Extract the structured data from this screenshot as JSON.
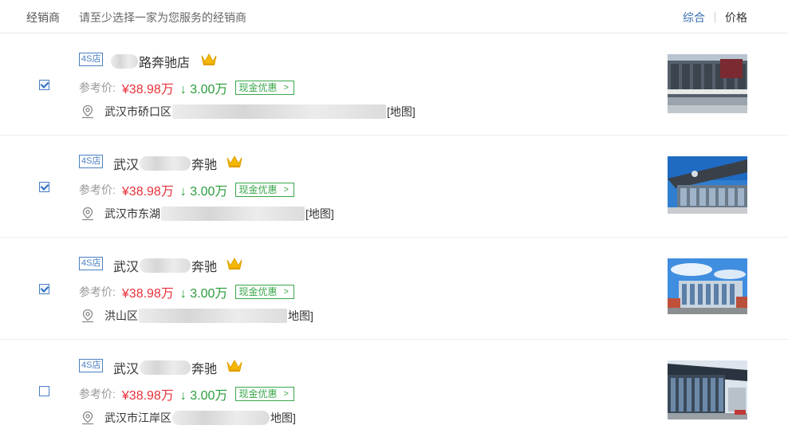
{
  "header": {
    "column_label": "经销商",
    "hint": "请至少选择一家为您服务的经销商",
    "sort_active": "综合",
    "sort_price": "价格"
  },
  "dealers": [
    {
      "tag": "4S店",
      "name_prefix": "",
      "name_suffix": "路奔驰店",
      "price_label": "参考价:",
      "price": "¥38.98万",
      "discount": "↓ 3.00万",
      "promo": "现金优惠",
      "address_prefix": "武汉市硚口区",
      "map_link": "[地图]",
      "checked": true
    },
    {
      "tag": "4S店",
      "name_prefix": "武汉",
      "name_suffix": "奔驰",
      "price_label": "参考价:",
      "price": "¥38.98万",
      "discount": "↓ 3.00万",
      "promo": "现金优惠",
      "address_prefix": "武汉市东湖",
      "map_link": "[地图]",
      "checked": true
    },
    {
      "tag": "4S店",
      "name_prefix": "武汉",
      "name_suffix": "奔驰",
      "price_label": "参考价:",
      "price": "¥38.98万",
      "discount": "↓ 3.00万",
      "promo": "现金优惠",
      "address_prefix": "洪山区",
      "map_link": "地图]",
      "checked": true
    },
    {
      "tag": "4S店",
      "name_prefix": "武汉",
      "name_suffix": "奔驰",
      "price_label": "参考价:",
      "price": "¥38.98万",
      "discount": "↓ 3.00万",
      "promo": "现金优惠",
      "address_prefix": "武汉市江岸区",
      "map_link": "地图]",
      "checked": false
    }
  ],
  "colors": {
    "accent": "#3a6fb0",
    "price": "#e8313a",
    "discount": "#2a9c3c",
    "crown": "#f5b800"
  }
}
